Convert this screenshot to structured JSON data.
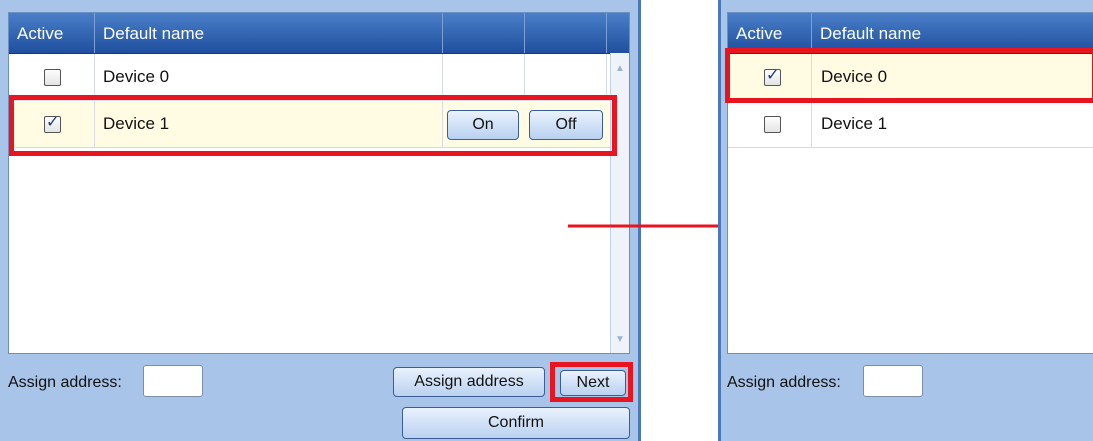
{
  "left": {
    "columns": [
      "Active",
      "Default name"
    ],
    "rows": [
      {
        "name": "Device 0",
        "active": false
      },
      {
        "name": "Device 1",
        "active": true
      }
    ],
    "on_label": "On",
    "off_label": "Off",
    "assign_label": "Assign address:",
    "assign_button": "Assign address",
    "next_button": "Next",
    "confirm_button": "Confirm"
  },
  "right": {
    "columns": [
      "Active",
      "Default name"
    ],
    "rows": [
      {
        "name": "Device 0",
        "active": true
      },
      {
        "name": "Device 1",
        "active": false
      }
    ],
    "assign_label": "Assign address:"
  },
  "colors": {
    "highlight": "#e81520",
    "header": "#2b5cab",
    "panel": "#a8c4e8",
    "selected_row": "#fffce3"
  },
  "icons": [
    "checkbox-checked-icon",
    "checkbox-empty-icon",
    "arrow-right-icon",
    "scroll-up-icon",
    "scroll-down-icon"
  ]
}
